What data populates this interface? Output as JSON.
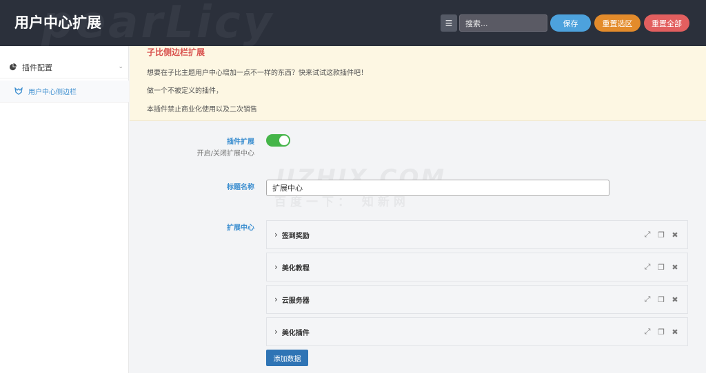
{
  "header": {
    "title": "用户中心扩展",
    "watermark": "pearLicy",
    "search_placeholder": "搜索...",
    "save_label": "保存",
    "reset_section_label": "重置选区",
    "reset_all_label": "重置全部"
  },
  "sidebar": {
    "items": [
      {
        "label": "插件配置",
        "icon": "pie-chart-icon",
        "expanded": true
      },
      {
        "label": "用户中心侧边栏",
        "icon": "wolf-logo-icon",
        "active": true
      }
    ]
  },
  "notice": {
    "title": "子比侧边栏扩展",
    "lines": [
      "想要在子比主题用户中心增加一点不一样的东西？快来试试这款插件吧！",
      "做一个不被定义的插件，",
      "本插件禁止商业化使用以及二次销售"
    ]
  },
  "fields": {
    "extension": {
      "label": "插件扩展",
      "sub": "开启/关闭扩展中心",
      "enabled": true
    },
    "title_name": {
      "label": "标题名称",
      "value": "扩展中心"
    },
    "center": {
      "label": "扩展中心",
      "groups": [
        "签到奖励",
        "美化教程",
        "云服务器",
        "美化插件"
      ]
    }
  },
  "add_button_label": "添加数据",
  "watermarks": {
    "main": "UZHIX.COM",
    "sub": "百度一下： 知新网"
  },
  "colors": {
    "header_bg": "#2b303b",
    "accent_blue": "#3d8fd0",
    "notice_bg": "#fdf7e3",
    "toggle_on": "#45b549",
    "save": "#4da2dd",
    "reset_section": "#e38b2b",
    "reset_all": "#e25f5f"
  }
}
